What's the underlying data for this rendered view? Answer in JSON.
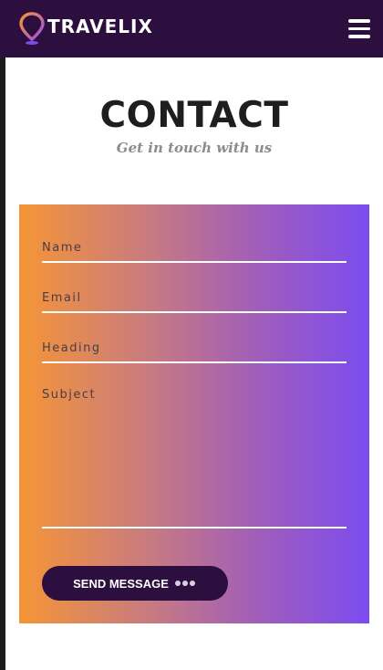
{
  "navbar": {
    "brand": "TRAVELIX",
    "logo_icon": "map-pin-icon",
    "menu_icon": "hamburger-menu-icon",
    "background": "#2c0f3e"
  },
  "header": {
    "title": "CONTACT",
    "subtitle": "Get in touch with us"
  },
  "form": {
    "name_placeholder": "Name",
    "email_placeholder": "Email",
    "heading_placeholder": "Heading",
    "subject_placeholder": "Subject",
    "send_label": "SEND MESSAGE",
    "gradient_start": "#f59536",
    "gradient_end": "#7c4cf0"
  }
}
